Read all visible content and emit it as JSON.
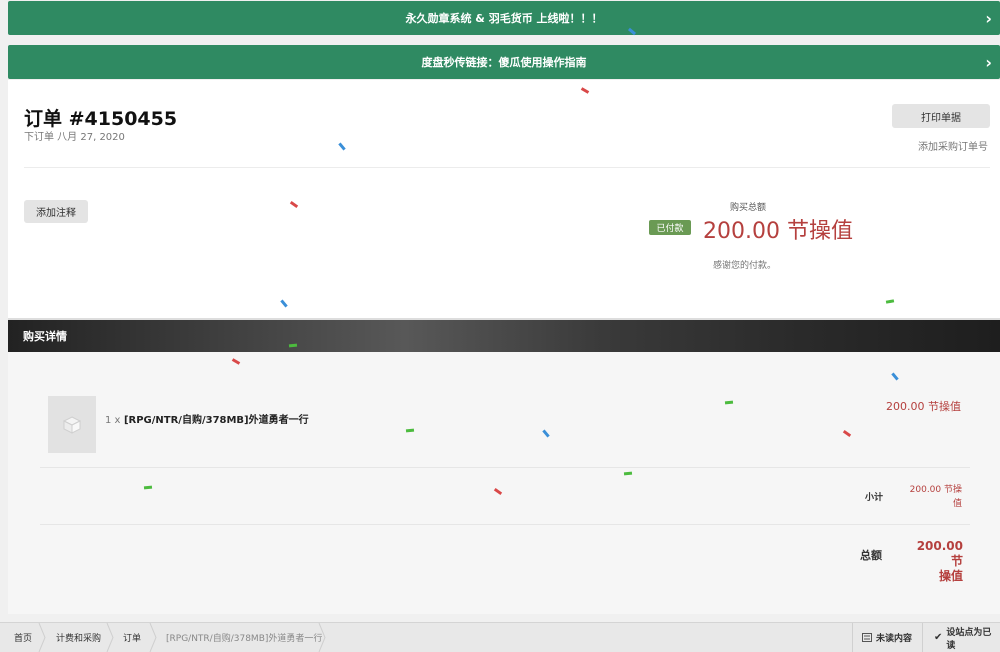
{
  "banners": [
    {
      "text": "永久勋章系统 & 羽毛货币 上线啦！！！"
    },
    {
      "text": "度盘秒传链接：傻瓜使用操作指南"
    }
  ],
  "order": {
    "title": "订单 #4150455",
    "date": "下订单 八月 27, 2020",
    "print_label": "打印单据",
    "po_link": "添加采购订单号",
    "note_label": "添加注释",
    "total_label": "购买总额",
    "paid_badge": "已付款",
    "total_amount": "200.00 节操值",
    "thanks": "感谢您的付款。"
  },
  "details": {
    "header": "购买详情",
    "item": {
      "qty": "1 x",
      "name": "[RPG/NTR/自购/378MB]外道勇者一行",
      "price": "200.00 节操值"
    },
    "subtotal_label": "小计",
    "subtotal_value_line1": "200.00 节操",
    "subtotal_value_line2": "值",
    "grand_label": "总额",
    "grand_value_line1": "200.00 节",
    "grand_value_line2": "操值"
  },
  "breadcrumb": [
    "首页",
    "计费和采购",
    "订单",
    "[RPG/NTR/自购/378MB]外道勇者一行"
  ],
  "footer": {
    "unread_label": "未读内容",
    "mark_read_label": "设站点为已读"
  },
  "colors": {
    "banner": "#2f8a62",
    "price": "#b5403e",
    "paid": "#6a9a54"
  }
}
